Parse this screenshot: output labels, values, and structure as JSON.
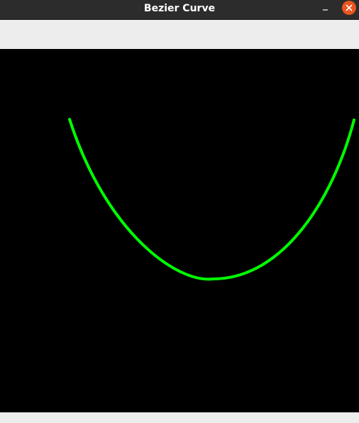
{
  "window": {
    "title": "Bezier Curve"
  },
  "canvas": {
    "background_color": "#000000",
    "curve_color": "#00ff00",
    "curve_type": "bezier"
  },
  "icons": {
    "minimize": "minimize-icon",
    "close": "close-icon"
  },
  "colors": {
    "titlebar": "#2c2c2c",
    "close_button": "#e95420",
    "window_background": "#ededed"
  }
}
